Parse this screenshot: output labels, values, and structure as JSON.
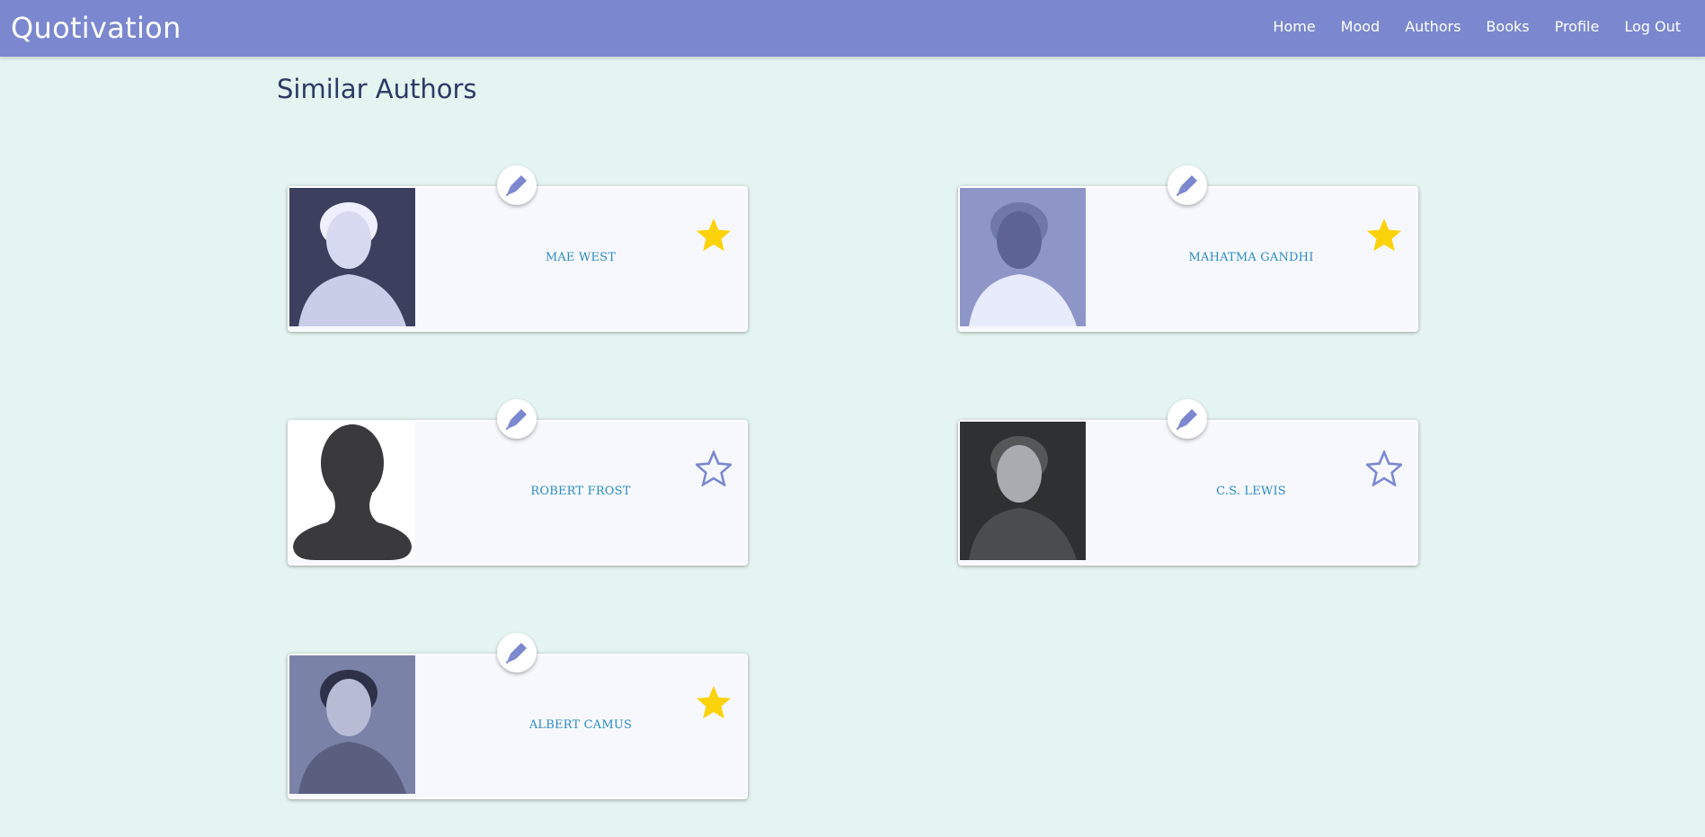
{
  "app": {
    "brand": "Quotivation"
  },
  "nav": {
    "items": [
      "Home",
      "Mood",
      "Authors",
      "Books",
      "Profile",
      "Log Out"
    ]
  },
  "page": {
    "title": "Similar Authors"
  },
  "colors": {
    "navbar": "#7b88cf",
    "background": "#e4f4f0",
    "author_name": "#2a8bc5",
    "star_filled": "#fcd20a",
    "star_outline": "#7b88cf",
    "pen_icon": "#7b88cf"
  },
  "authors": [
    {
      "name": "MAE WEST",
      "favorite": true,
      "photo": "mae-west-photo"
    },
    {
      "name": "MAHATMA GANDHI",
      "favorite": true,
      "photo": "mahatma-gandhi-photo"
    },
    {
      "name": "ROBERT FROST",
      "favorite": false,
      "photo": "default-avatar-silhouette"
    },
    {
      "name": "C.S. LEWIS",
      "favorite": false,
      "photo": "cs-lewis-photo"
    },
    {
      "name": "ALBERT CAMUS",
      "favorite": true,
      "photo": "albert-camus-photo"
    }
  ]
}
